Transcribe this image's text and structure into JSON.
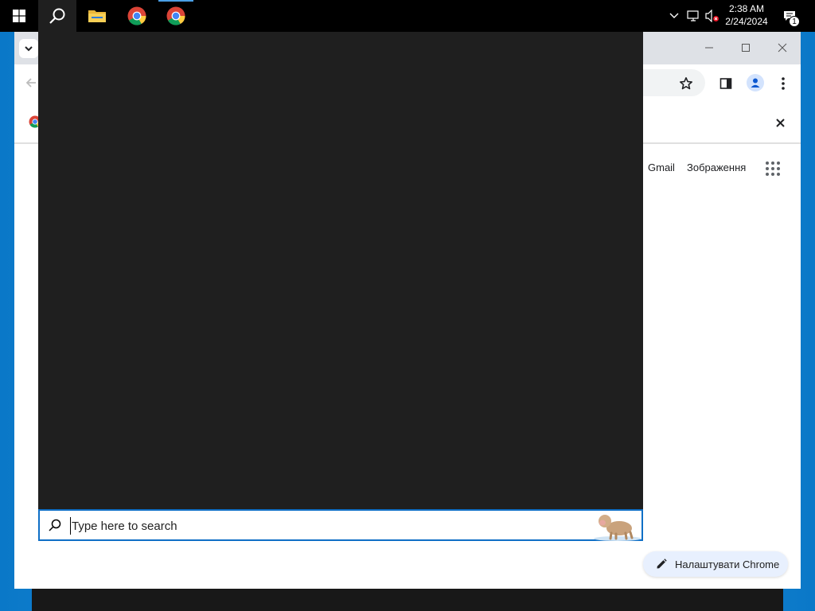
{
  "taskbar": {
    "clock_time": "2:38 AM",
    "clock_date": "2/24/2024",
    "notification_count": "1",
    "apps": [
      "Start",
      "Search",
      "File Explorer",
      "Google Chrome",
      "Google Chrome"
    ]
  },
  "chrome": {
    "header_links": {
      "gmail": "Gmail",
      "images": "Зображення"
    },
    "customize_label": "Налаштувати Chrome"
  },
  "search": {
    "placeholder": "Type here to search"
  },
  "colors": {
    "taskbar": "#000000",
    "search_panel": "#1f1f1f",
    "accent": "#0f6fc6",
    "desktop": "#0a78c8"
  }
}
